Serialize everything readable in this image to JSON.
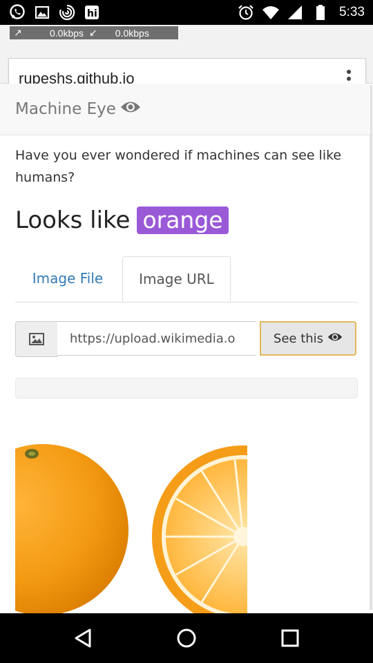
{
  "status_bar": {
    "time": "5:33",
    "left_icons": [
      "whatsapp-icon",
      "gallery-icon",
      "spiral-app-icon",
      "hike-app-icon"
    ],
    "right_icons": [
      "alarm-icon",
      "wifi-icon",
      "signal-icon",
      "battery-icon"
    ]
  },
  "network_speed": {
    "upload": "0.0kbps",
    "download": "0.0kbps"
  },
  "browser": {
    "url": "rupeshs.github.io"
  },
  "app": {
    "brand": "Machine Eye",
    "intro": "Have you ever wondered if machines can see like humans?",
    "result_prefix": "Looks like",
    "result_label": "orange",
    "accent_color": "#9a5ad8"
  },
  "tabs": [
    {
      "label": "Image File",
      "active": false
    },
    {
      "label": "Image URL",
      "active": true
    }
  ],
  "url_form": {
    "value": "https://upload.wikimedia.o",
    "button_label": "See this"
  },
  "progress": 0,
  "preview": {
    "subject": "two oranges, one whole and one cut in half"
  },
  "nav_bar": {
    "buttons": [
      "back-icon",
      "home-icon",
      "recents-icon"
    ]
  }
}
